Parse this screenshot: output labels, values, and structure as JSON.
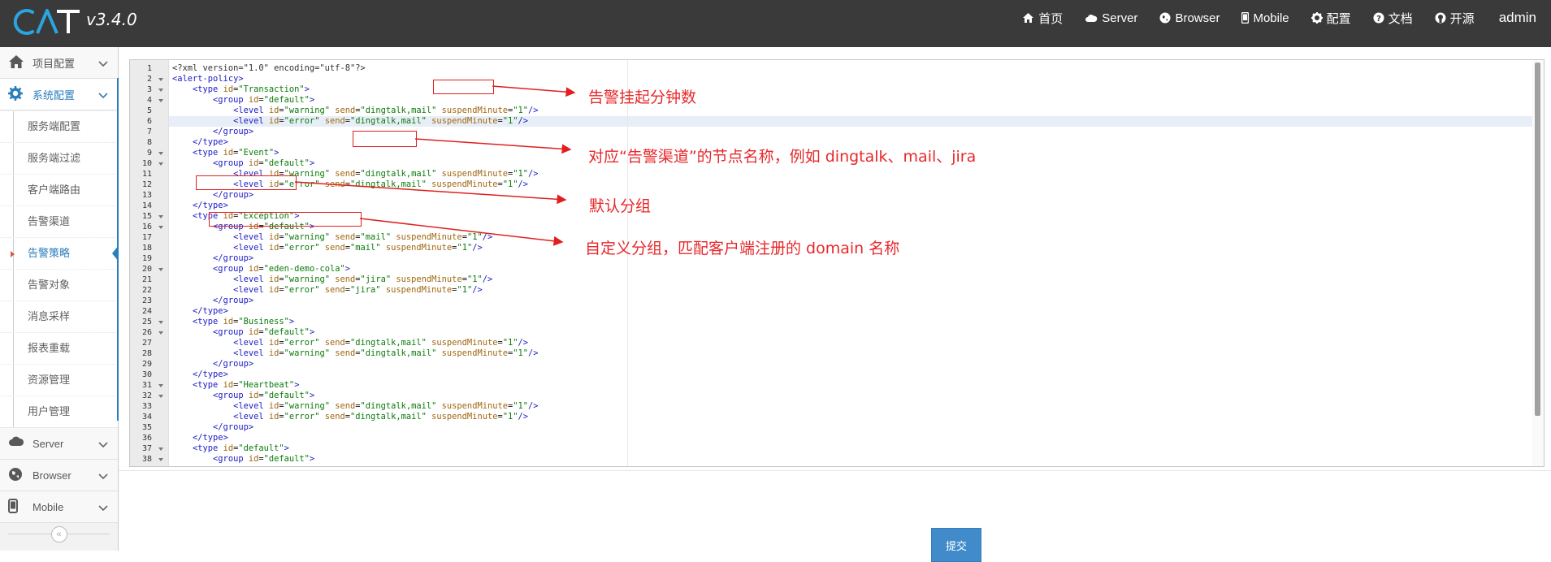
{
  "header": {
    "logo_text": "CAT",
    "version": "v3.4.0",
    "nav": [
      {
        "label": "首页",
        "icon": "home-icon"
      },
      {
        "label": "Server",
        "icon": "cloud-icon"
      },
      {
        "label": "Browser",
        "icon": "globe-icon"
      },
      {
        "label": "Mobile",
        "icon": "mobile-icon"
      },
      {
        "label": "配置",
        "icon": "gear-icon"
      },
      {
        "label": "文档",
        "icon": "question-circle-icon"
      },
      {
        "label": "开源",
        "icon": "github-icon"
      }
    ],
    "user": "admin"
  },
  "sidebar": {
    "project": {
      "label": "项目配置",
      "icon": "home-icon"
    },
    "system": {
      "label": "系统配置",
      "icon": "gear-icon"
    },
    "system_items": [
      "服务端配置",
      "服务端过滤",
      "客户端路由",
      "告警渠道",
      "告警策略",
      "告警对象",
      "消息采样",
      "报表重载",
      "资源管理",
      "用户管理"
    ],
    "active_item": "告警策略",
    "server": {
      "label": "Server",
      "icon": "cloud-icon"
    },
    "browser": {
      "label": "Browser",
      "icon": "globe-icon"
    },
    "mobile": {
      "label": "Mobile",
      "icon": "mobile-icon"
    },
    "collapse_icon": "double-chevron-left-icon"
  },
  "editor": {
    "lines": [
      "<?xml version=\"1.0\" encoding=\"utf-8\"?>",
      "<alert-policy>",
      "    <type id=\"Transaction\">",
      "        <group id=\"default\">",
      "            <level id=\"warning\" send=\"dingtalk,mail\" suspendMinute=\"1\"/>",
      "            <level id=\"error\" send=\"dingtalk,mail\" suspendMinute=\"1\"/>",
      "        </group>",
      "    </type>",
      "    <type id=\"Event\">",
      "        <group id=\"default\">",
      "            <level id=\"warning\" send=\"dingtalk,mail\" suspendMinute=\"1\"/>",
      "            <level id=\"error\" send=\"dingtalk,mail\" suspendMinute=\"1\"/>",
      "        </group>",
      "    </type>",
      "    <type id=\"Exception\">",
      "        <group id=\"default\">",
      "            <level id=\"warning\" send=\"mail\" suspendMinute=\"1\"/>",
      "            <level id=\"error\" send=\"mail\" suspendMinute=\"1\"/>",
      "        </group>",
      "        <group id=\"eden-demo-cola\">",
      "            <level id=\"warning\" send=\"jira\" suspendMinute=\"1\"/>",
      "            <level id=\"error\" send=\"jira\" suspendMinute=\"1\"/>",
      "        </group>",
      "    </type>",
      "    <type id=\"Business\">",
      "        <group id=\"default\">",
      "            <level id=\"error\" send=\"dingtalk,mail\" suspendMinute=\"1\"/>",
      "            <level id=\"warning\" send=\"dingtalk,mail\" suspendMinute=\"1\"/>",
      "        </group>",
      "    </type>",
      "    <type id=\"Heartbeat\">",
      "        <group id=\"default\">",
      "            <level id=\"warning\" send=\"dingtalk,mail\" suspendMinute=\"1\"/>",
      "            <level id=\"error\" send=\"dingtalk,mail\" suspendMinute=\"1\"/>",
      "        </group>",
      "    </type>",
      "    <type id=\"default\">",
      "        <group id=\"default\">"
    ],
    "fold_lines": [
      2,
      3,
      4,
      9,
      10,
      15,
      16,
      20,
      25,
      26,
      31,
      32,
      37,
      38
    ],
    "active_line": 6
  },
  "annotations": [
    {
      "text": "告警挂起分钟数"
    },
    {
      "text": "对应“告警渠道”的节点名称，例如 dingtalk、mail、jira"
    },
    {
      "text": "默认分组"
    },
    {
      "text": "自定义分组，匹配客户端注册的 domain 名称"
    }
  ],
  "submit_label": "提交"
}
